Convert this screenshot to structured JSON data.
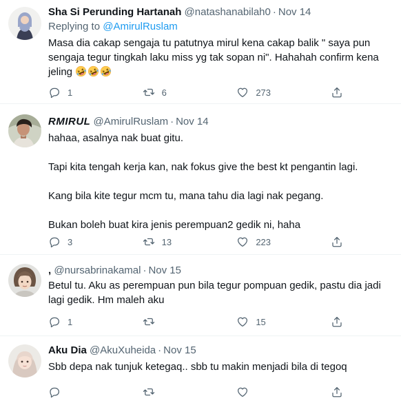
{
  "tweets": [
    {
      "name": "Sha Si Perunding Hartanah",
      "handle": "@natashanabilah0",
      "sep": "·",
      "date": "Nov 14",
      "replying_prefix": "Replying to",
      "replying_handle": "@AmirulRuslam",
      "lines": [
        "Masa dia cakap sengaja tu patutnya mirul kena cakap balik \" saya pun",
        "sengaja tegur tingkah laku miss yg tak sopan ni\". Hahahah confirm kena",
        "jeling"
      ],
      "emoji": "rolling-on-floor-laughing-face",
      "reply_count": "1",
      "retweet_count": "6",
      "like_count": "273"
    },
    {
      "name": "RMIRUL",
      "handle": "@AmirulRuslam",
      "sep": "·",
      "date": "Nov 14",
      "lines": [
        "hahaa, asalnya nak buat gitu.",
        "",
        "Tapi kita tengah kerja kan, nak fokus give the best kt pengantin lagi.",
        "",
        "Kang bila kite tegur mcm tu, mana tahu dia lagi nak pegang.",
        "",
        "Bukan boleh buat kira jenis perempuan2 gedik ni, haha"
      ],
      "reply_count": "3",
      "retweet_count": "13",
      "like_count": "223"
    },
    {
      "name": ",",
      "handle": "@nursabrinakamal",
      "sep": "·",
      "date": "Nov 15",
      "lines": [
        "Betul tu. Aku as perempuan pun bila tegur pompuan gedik, pastu dia jadi",
        "lagi gedik. Hm maleh aku"
      ],
      "reply_count": "1",
      "retweet_count": "",
      "like_count": "15"
    },
    {
      "name": "Aku Dia",
      "handle": "@AkuXuheida",
      "sep": "·",
      "date": "Nov 15",
      "lines": [
        "Sbb depa nak tunjuk ketegaq.. sbb tu makin menjadi bila di tegoq"
      ],
      "reply_count": "",
      "retweet_count": "",
      "like_count": ""
    }
  ],
  "icons": {
    "reply": "reply-bubble-icon",
    "retweet": "retweet-icon",
    "like": "heart-icon",
    "share": "share-icon"
  },
  "colors": {
    "text": "#0f1419",
    "secondary": "#536471",
    "link": "#1d9bf0",
    "divider": "#eff3f4"
  }
}
